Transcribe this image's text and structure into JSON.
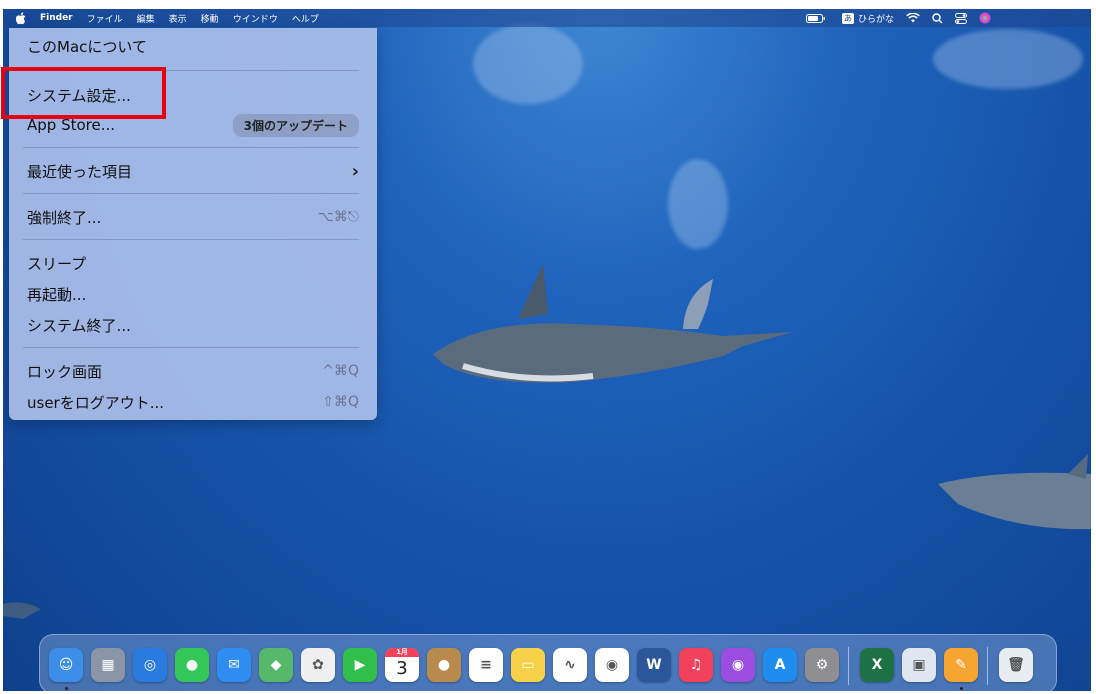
{
  "menubar": {
    "apple_icon": "apple-logo-icon",
    "items": [
      "Finder",
      "ファイル",
      "編集",
      "表示",
      "移動",
      "ウインドウ",
      "ヘルプ"
    ],
    "status": {
      "battery_icon": "battery-icon",
      "ime_badge": "あ",
      "ime_label": "ひらがな",
      "wifi_icon": "wifi-icon",
      "search_icon": "search-icon",
      "control_center_icon": "control-center-icon",
      "siri_icon": "siri-icon"
    }
  },
  "apple_menu": {
    "about": "このMacについて",
    "system_settings": "システム設定...",
    "app_store": "App Store...",
    "app_store_badge": "3個のアップデート",
    "recent_items": "最近使った項目",
    "force_quit": "強制終了...",
    "force_quit_shortcut": "⌥⌘⎋",
    "sleep": "スリープ",
    "restart": "再起動...",
    "shutdown": "システム終了...",
    "lock_screen": "ロック画面",
    "lock_screen_shortcut": "^⌘Q",
    "logout": "userをログアウト...",
    "logout_shortcut": "⇧⌘Q"
  },
  "annotation": {
    "highlight_color": "#e60012",
    "highlight_target": "system-settings"
  },
  "dock": {
    "apps": [
      {
        "name": "Finder",
        "icon": "finder-icon",
        "color": "#3d8ee8",
        "running": true
      },
      {
        "name": "Launchpad",
        "icon": "launchpad-icon",
        "color": "#8a96a8",
        "running": false
      },
      {
        "name": "Safari",
        "icon": "safari-icon",
        "color": "#2a7be0",
        "running": false
      },
      {
        "name": "Messages",
        "icon": "messages-icon",
        "color": "#34c759",
        "running": false
      },
      {
        "name": "Mail",
        "icon": "mail-icon",
        "color": "#2f8cf0",
        "running": false
      },
      {
        "name": "Maps",
        "icon": "maps-icon",
        "color": "#56b86a",
        "running": false
      },
      {
        "name": "Photos",
        "icon": "photos-icon",
        "color": "#f0f0f0",
        "running": false
      },
      {
        "name": "FaceTime",
        "icon": "facetime-icon",
        "color": "#2fbf4a",
        "running": false
      },
      {
        "name": "Calendar",
        "icon": "calendar-icon",
        "color": "#ffffff",
        "running": false,
        "month": "1月",
        "day": "3"
      },
      {
        "name": "Contacts",
        "icon": "contacts-icon",
        "color": "#b98a4e",
        "running": false
      },
      {
        "name": "Reminders",
        "icon": "reminders-icon",
        "color": "#ffffff",
        "running": false
      },
      {
        "name": "Notes",
        "icon": "notes-icon",
        "color": "#f7d14a",
        "running": false
      },
      {
        "name": "Freeform",
        "icon": "freeform-icon",
        "color": "#ffffff",
        "running": false
      },
      {
        "name": "Chrome",
        "icon": "chrome-icon",
        "color": "#ffffff",
        "running": false
      },
      {
        "name": "Word",
        "icon": "word-icon",
        "color": "#2b579a",
        "running": false
      },
      {
        "name": "Music",
        "icon": "music-icon",
        "color": "#f2415a",
        "running": false
      },
      {
        "name": "Podcasts",
        "icon": "podcasts-icon",
        "color": "#9b4de0",
        "running": false
      },
      {
        "name": "App Store",
        "icon": "app-store-icon",
        "color": "#1f8cf0",
        "running": false
      },
      {
        "name": "System Settings",
        "icon": "system-settings-icon",
        "color": "#8e8e93",
        "running": false
      },
      {
        "name": "Excel",
        "icon": "excel-icon",
        "color": "#1e7145",
        "running": false
      },
      {
        "name": "Preview",
        "icon": "preview-icon",
        "color": "#dfe6ef",
        "running": false
      },
      {
        "name": "Pages",
        "icon": "pages-icon",
        "color": "#f7a531",
        "running": true
      },
      {
        "name": "Trash",
        "icon": "trash-icon",
        "color": "#e8edf2",
        "running": false
      }
    ]
  }
}
